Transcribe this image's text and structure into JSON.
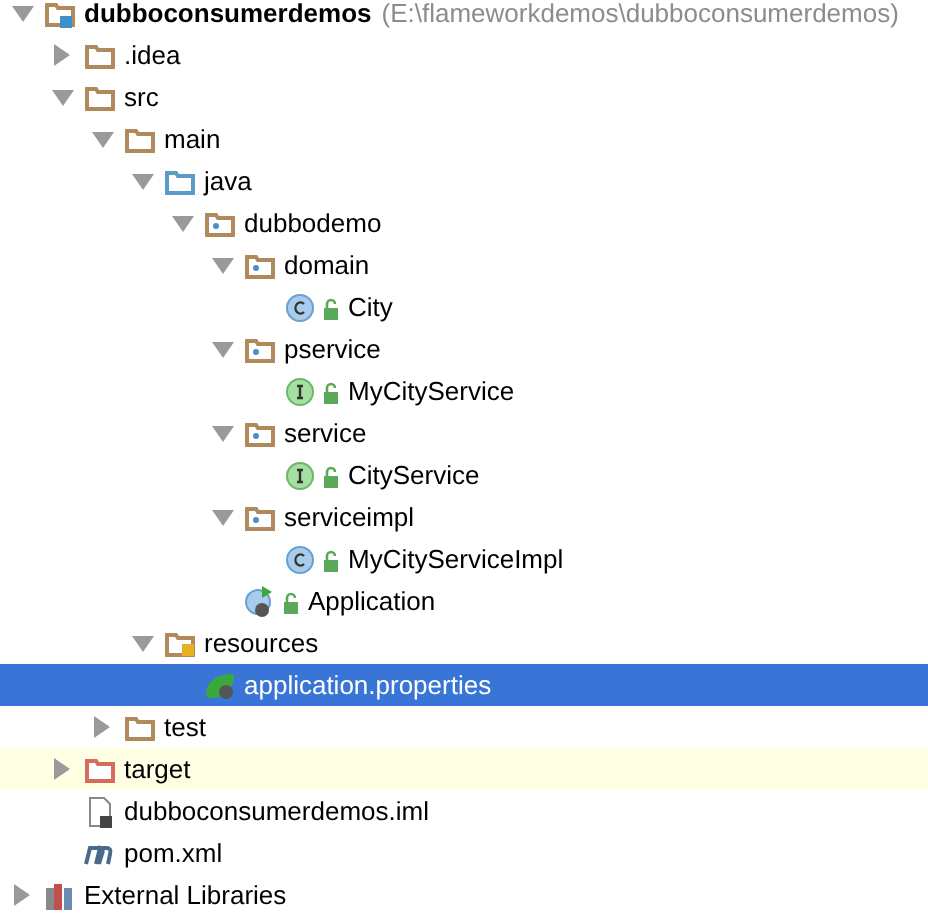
{
  "tree": [
    {
      "label": "dubboconsumerdemos",
      "path": "(E:\\flameworkdemos\\dubboconsumerdemos)",
      "kind": "module",
      "expanded": true,
      "selected": false,
      "excluded": false,
      "children": [
        {
          "label": ".idea",
          "kind": "folder",
          "expanded": false,
          "selected": false,
          "excluded": false
        },
        {
          "label": "src",
          "kind": "folder",
          "expanded": true,
          "selected": false,
          "excluded": false,
          "children": [
            {
              "label": "main",
              "kind": "folder",
              "expanded": true,
              "selected": false,
              "excluded": false,
              "children": [
                {
                  "label": "java",
                  "kind": "source-folder",
                  "expanded": true,
                  "selected": false,
                  "excluded": false,
                  "children": [
                    {
                      "label": "dubbodemo",
                      "kind": "package",
                      "expanded": true,
                      "selected": false,
                      "excluded": false,
                      "children": [
                        {
                          "label": "domain",
                          "kind": "package",
                          "expanded": true,
                          "selected": false,
                          "excluded": false,
                          "children": [
                            {
                              "label": "City",
                              "kind": "class",
                              "selected": false,
                              "excluded": false
                            }
                          ]
                        },
                        {
                          "label": "pservice",
                          "kind": "package",
                          "expanded": true,
                          "selected": false,
                          "excluded": false,
                          "children": [
                            {
                              "label": "MyCityService",
                              "kind": "interface",
                              "selected": false,
                              "excluded": false
                            }
                          ]
                        },
                        {
                          "label": "service",
                          "kind": "package",
                          "expanded": true,
                          "selected": false,
                          "excluded": false,
                          "children": [
                            {
                              "label": "CityService",
                              "kind": "interface",
                              "selected": false,
                              "excluded": false
                            }
                          ]
                        },
                        {
                          "label": "serviceimpl",
                          "kind": "package",
                          "expanded": true,
                          "selected": false,
                          "excluded": false,
                          "children": [
                            {
                              "label": "MyCityServiceImpl",
                              "kind": "class",
                              "selected": false,
                              "excluded": false
                            }
                          ]
                        },
                        {
                          "label": "Application",
                          "kind": "app",
                          "selected": false,
                          "excluded": false
                        }
                      ]
                    }
                  ]
                },
                {
                  "label": "resources",
                  "kind": "resources-folder",
                  "expanded": true,
                  "selected": false,
                  "excluded": false,
                  "children": [
                    {
                      "label": "application.properties",
                      "kind": "properties",
                      "selected": true,
                      "excluded": false
                    }
                  ]
                }
              ]
            },
            {
              "label": "test",
              "kind": "folder",
              "expanded": false,
              "selected": false,
              "excluded": false
            }
          ]
        },
        {
          "label": "target",
          "kind": "excluded-folder",
          "expanded": false,
          "selected": false,
          "excluded": true
        },
        {
          "label": "dubboconsumerdemos.iml",
          "kind": "iml",
          "selected": false,
          "excluded": false
        },
        {
          "label": "pom.xml",
          "kind": "maven",
          "selected": false,
          "excluded": false
        }
      ]
    },
    {
      "label": "External Libraries",
      "kind": "libraries",
      "expanded": false,
      "selected": false,
      "excluded": false
    }
  ]
}
